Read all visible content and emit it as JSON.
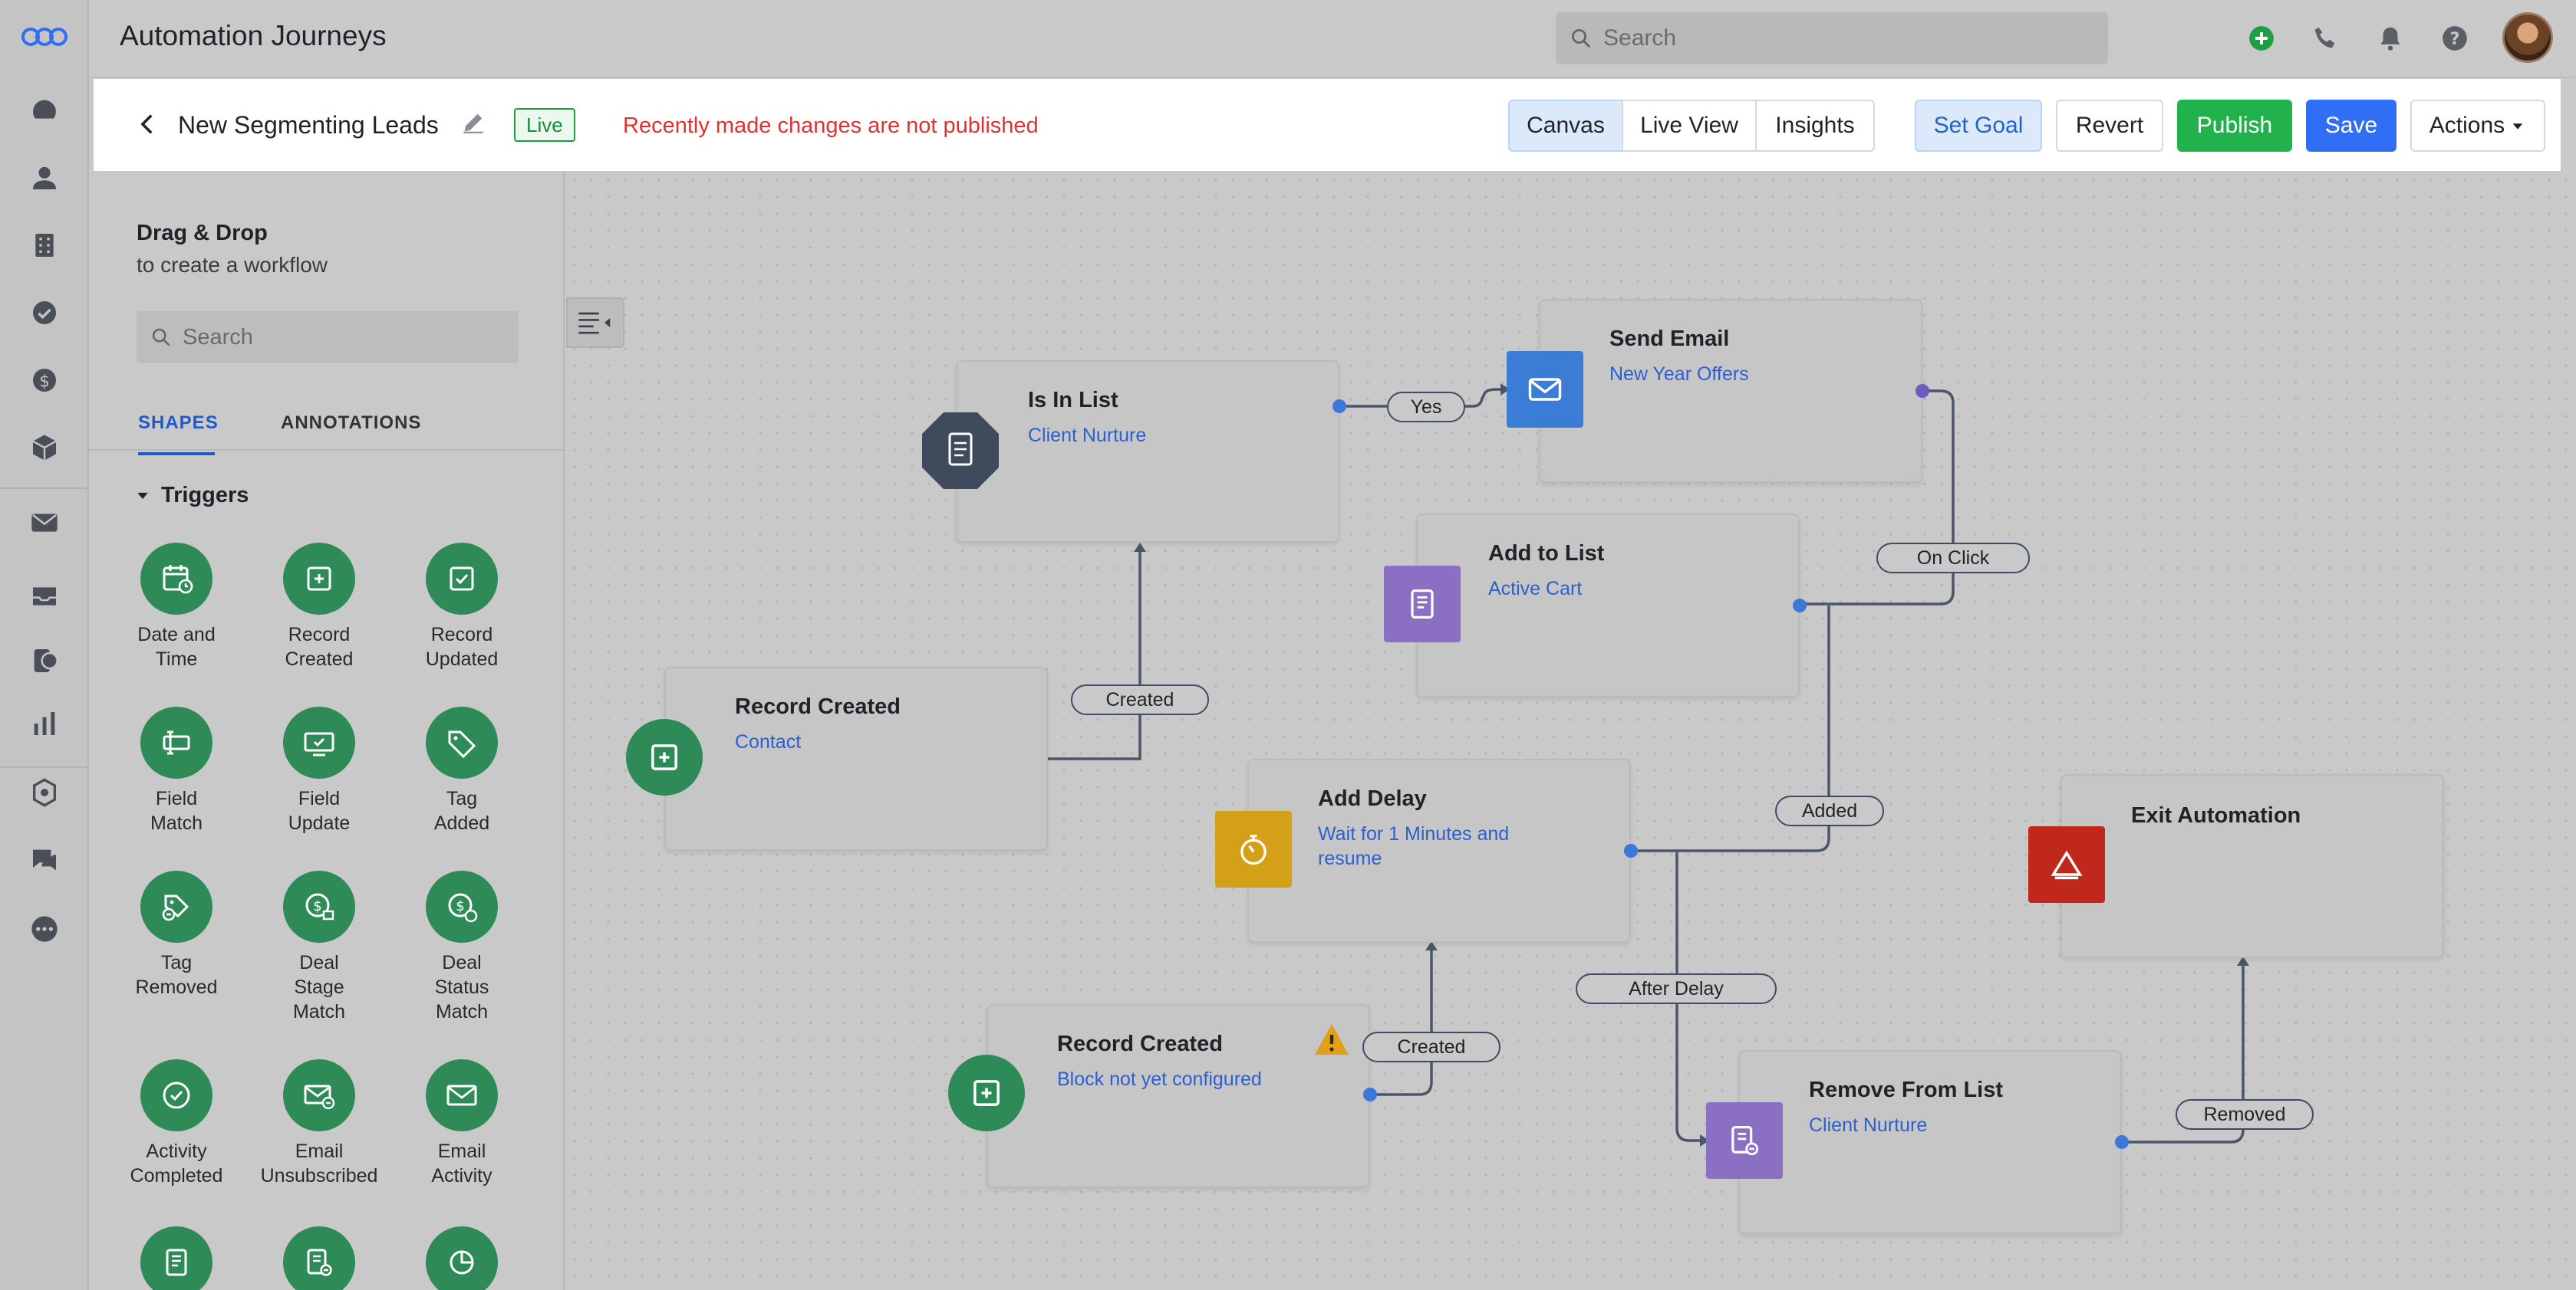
{
  "app": {
    "title": "Automation Journeys"
  },
  "topbar": {
    "search_placeholder": "Search"
  },
  "header": {
    "journey_name": "New Segmenting Leads",
    "status_badge": "Live",
    "warning": "Recently made changes are not published",
    "views": [
      "Canvas",
      "Live View",
      "Insights"
    ],
    "active_view": "Canvas",
    "buttons": {
      "set_goal": "Set Goal",
      "revert": "Revert",
      "publish": "Publish",
      "save": "Save",
      "actions": "Actions"
    }
  },
  "panel": {
    "title": "Drag & Drop",
    "subtitle": "to create a workflow",
    "search_placeholder": "Search",
    "tabs": [
      "SHAPES",
      "ANNOTATIONS"
    ],
    "section": "Triggers",
    "shapes": [
      {
        "label": "Date and\nTime",
        "icon": "calendar-clock-icon"
      },
      {
        "label": "Record\nCreated",
        "icon": "plus-square-icon"
      },
      {
        "label": "Record\nUpdated",
        "icon": "check-square-icon"
      },
      {
        "label": "Field\nMatch",
        "icon": "field-match-icon"
      },
      {
        "label": "Field\nUpdate",
        "icon": "field-update-icon"
      },
      {
        "label": "Tag\nAdded",
        "icon": "tag-icon"
      },
      {
        "label": "Tag\nRemoved",
        "icon": "tag-remove-icon"
      },
      {
        "label": "Deal\nStage\nMatch",
        "icon": "deal-stage-icon"
      },
      {
        "label": "Deal\nStatus\nMatch",
        "icon": "deal-status-icon"
      },
      {
        "label": "Activity\nCompleted",
        "icon": "check-circle-icon"
      },
      {
        "label": "Email\nUnsubscribed",
        "icon": "email-unsub-icon"
      },
      {
        "label": "Email\nActivity",
        "icon": "email-icon"
      }
    ]
  },
  "nodes": {
    "is_in_list": {
      "title": "Is In List",
      "sub": "Client Nurture"
    },
    "send_email": {
      "title": "Send Email",
      "sub": "New Year Offers"
    },
    "add_to_list": {
      "title": "Add to List",
      "sub": "Active Cart"
    },
    "record_created_1": {
      "title": "Record Created",
      "sub": "Contact"
    },
    "add_delay": {
      "title": "Add Delay",
      "sub": "Wait for 1 Minutes and resume"
    },
    "exit": {
      "title": "Exit Automation"
    },
    "record_created_2": {
      "title": "Record Created",
      "sub": "Block not yet configured"
    },
    "remove_from_list": {
      "title": "Remove From List",
      "sub": "Client Nurture"
    }
  },
  "edges": {
    "yes": "Yes",
    "on_click": "On Click",
    "created_1": "Created",
    "added": "Added",
    "after_delay": "After Delay",
    "created_2": "Created",
    "removed": "Removed"
  },
  "colors": {
    "trigger_green": "#2e8b57",
    "condition_dark": "#3f4a5c",
    "email_blue": "#3b7cd6",
    "list_purple": "#8a6fc2",
    "delay_yellow": "#d4a017",
    "exit_red": "#c0281c",
    "publish_green": "#22b24c",
    "save_blue": "#2f6ef5",
    "warning_red": "#e03131"
  }
}
